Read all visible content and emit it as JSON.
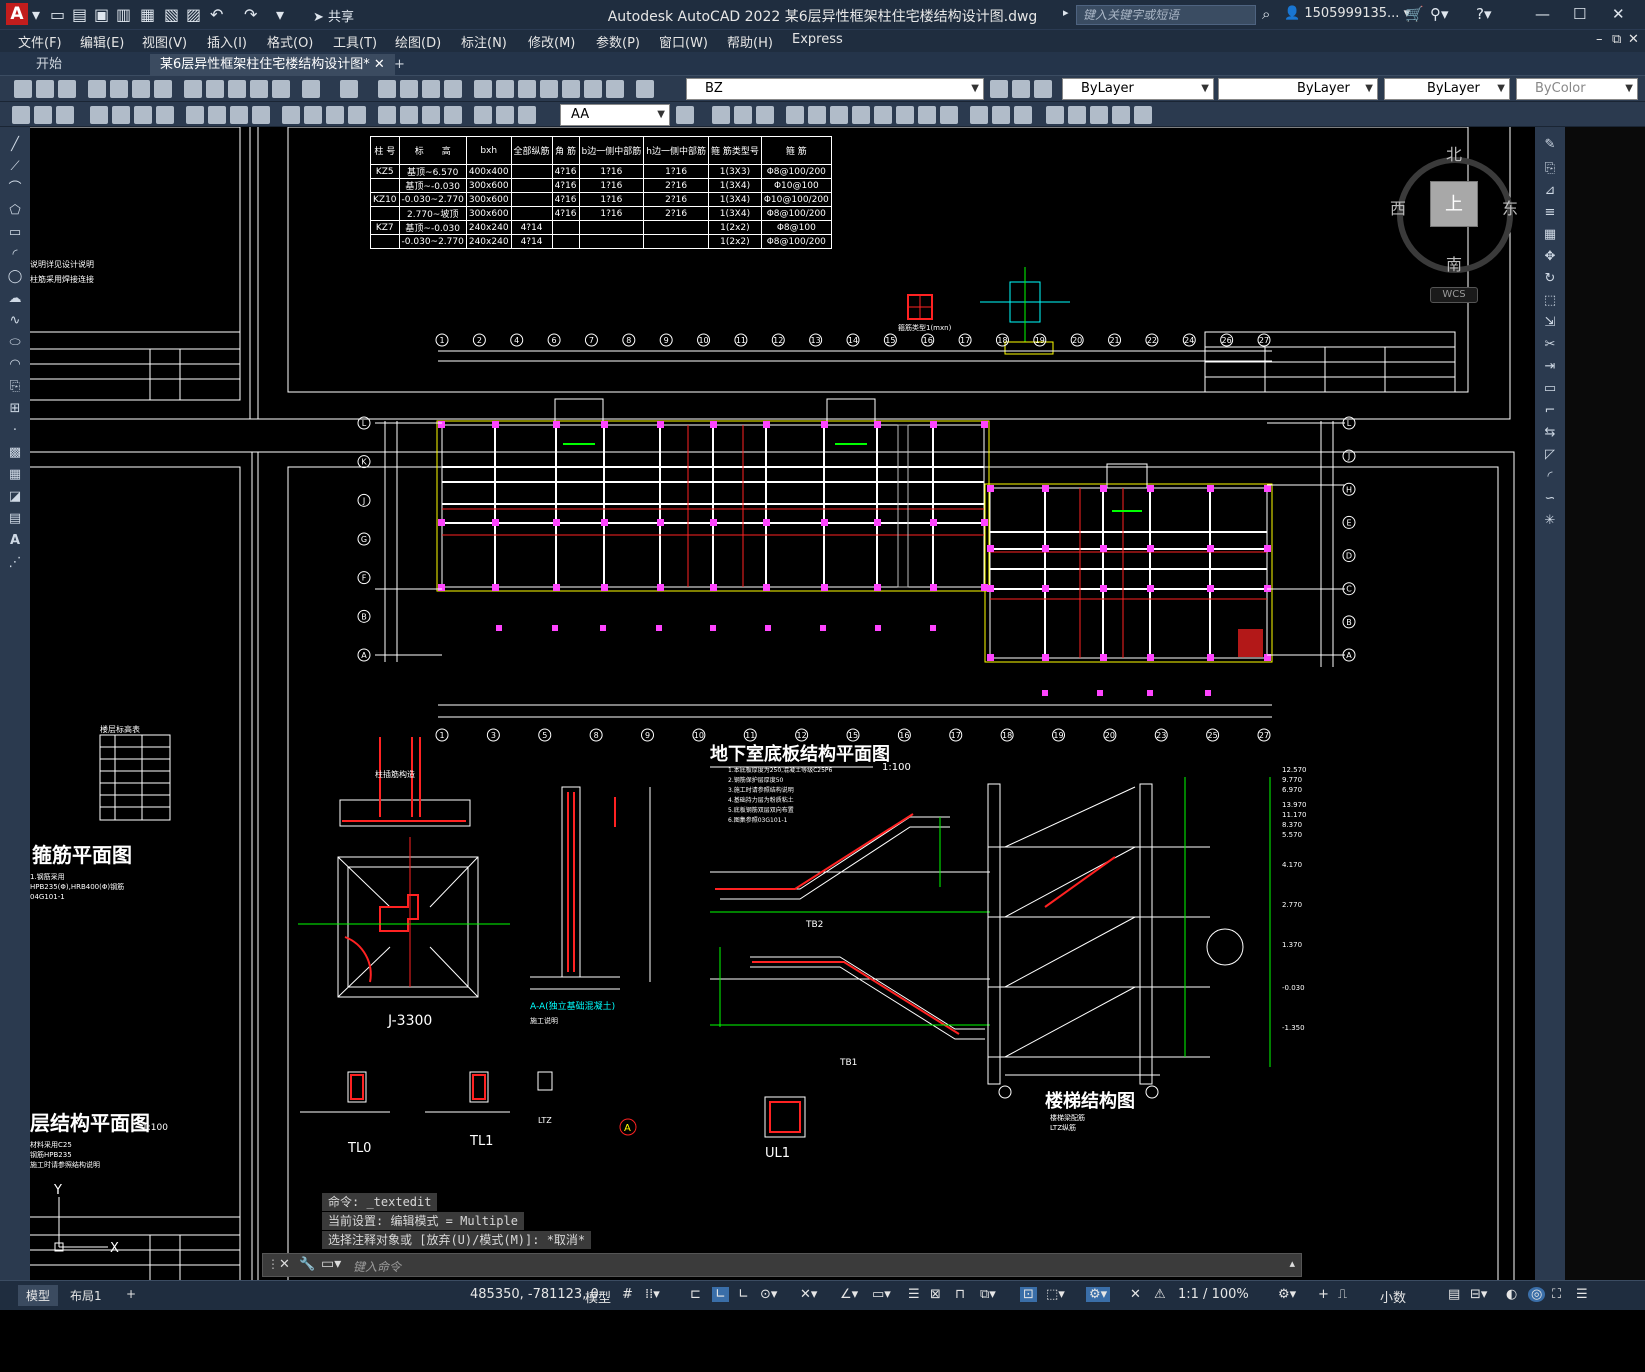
{
  "app": {
    "window_title": "Autodesk AutoCAD 2022    某6层异性框架柱住宅楼结构设计图.dwg",
    "share_label": "共享",
    "search_placeholder": "键入关键字或短语",
    "account": "1505999135...",
    "win_min": "—",
    "win_max": "☐",
    "win_close": "✕"
  },
  "menu": [
    "文件(F)",
    "编辑(E)",
    "视图(V)",
    "插入(I)",
    "格式(O)",
    "工具(T)",
    "绘图(D)",
    "标注(N)",
    "修改(M)",
    "参数(P)",
    "窗口(W)",
    "帮助(H)",
    "Express"
  ],
  "tabs": [
    {
      "label": "开始"
    },
    {
      "label": "某6层异性框架柱住宅楼结构设计图*"
    }
  ],
  "toolbar": {
    "layer": "BZ",
    "color": "ByLayer",
    "linetype": "ByLayer",
    "lineweight": "ByLayer",
    "plotstyle": "ByColor",
    "textstyle": "AA"
  },
  "viewcube": {
    "north": "北",
    "south": "南",
    "east": "东",
    "west": "西",
    "top": "上",
    "wcs": "WCS"
  },
  "drawing": {
    "column_table_headers": [
      "柱 号",
      "标　　高",
      "bxh",
      "全部纵筋",
      "角 筋",
      "b边一侧中部筋",
      "h边一侧中部筋",
      "箍 筋类型号",
      "箍 筋"
    ],
    "column_table_rows": [
      [
        "KZ5",
        "基顶~6.570",
        "400x400",
        "",
        "4?16",
        "1?16",
        "1?16",
        "1(3X3)",
        "Φ8@100/200"
      ],
      [
        "",
        "基顶~-0.030",
        "300x600",
        "",
        "4?16",
        "1?16",
        "2?16",
        "1(3X4)",
        "Φ10@100"
      ],
      [
        "KZ10",
        "-0.030~2.770",
        "300x600",
        "",
        "4?16",
        "1?16",
        "2?16",
        "1(3X4)",
        "Φ10@100/200"
      ],
      [
        "",
        "2.770~坡顶",
        "300x600",
        "",
        "4?16",
        "1?16",
        "2?16",
        "1(3X4)",
        "Φ8@100/200"
      ],
      [
        "KZ7",
        "基顶~-0.030",
        "240x240",
        "4?14",
        "",
        "",
        "",
        "1(2x2)",
        "Φ8@100"
      ],
      [
        "",
        "-0.030~2.770",
        "240x240",
        "4?14",
        "",
        "",
        "",
        "1(2x2)",
        "Φ8@100/200"
      ]
    ],
    "plan_title": "地下室底板结构平面图",
    "plan_scale": "1:100",
    "stair_title": "楼梯结构图",
    "left_title_1": "箍筋平面图",
    "left_title_2": "层结构平面图",
    "left_scale_2": "1:100",
    "detail_j": "J-3300",
    "detail_aa": "A-A(独立基础混凝土)",
    "tl0": "TL0",
    "tl1": "TL1",
    "tb1": "TB1",
    "tb2": "TB2",
    "ltz": "LTZ",
    "ul1": "UL1",
    "axis_top": [
      "1",
      "2",
      "4",
      "6",
      "7",
      "8",
      "9",
      "10",
      "11",
      "12",
      "13",
      "14",
      "15",
      "16",
      "17",
      "18",
      "19",
      "20",
      "21",
      "22",
      "24",
      "26",
      "27"
    ],
    "axis_bottom": [
      "1",
      "3",
      "5",
      "8",
      "9",
      "10",
      "11",
      "12",
      "15",
      "16",
      "17",
      "18",
      "19",
      "20",
      "23",
      "25",
      "27"
    ],
    "axis_left": [
      "L",
      "K",
      "J",
      "G",
      "F",
      "B",
      "A"
    ],
    "axis_right": [
      "L",
      "J",
      "H",
      "E",
      "D",
      "C",
      "B",
      "A"
    ]
  },
  "command": {
    "history": [
      "命令: _textedit",
      "当前设置: 编辑模式 = Multiple",
      "选择注释对象或 [放弃(U)/模式(M)]: *取消*"
    ],
    "input_placeholder": "键入命令"
  },
  "status": {
    "layout_tabs": [
      "模型",
      "布局1"
    ],
    "coords": "485350, -781123, 0",
    "model": "模型",
    "scale": "1:1 / 100%",
    "units": "小数"
  },
  "colors": {
    "accent": "#c21d1d",
    "titlebar": "#1f2d3f",
    "toolbar": "#2b3a4f",
    "canvas": "#000000"
  }
}
